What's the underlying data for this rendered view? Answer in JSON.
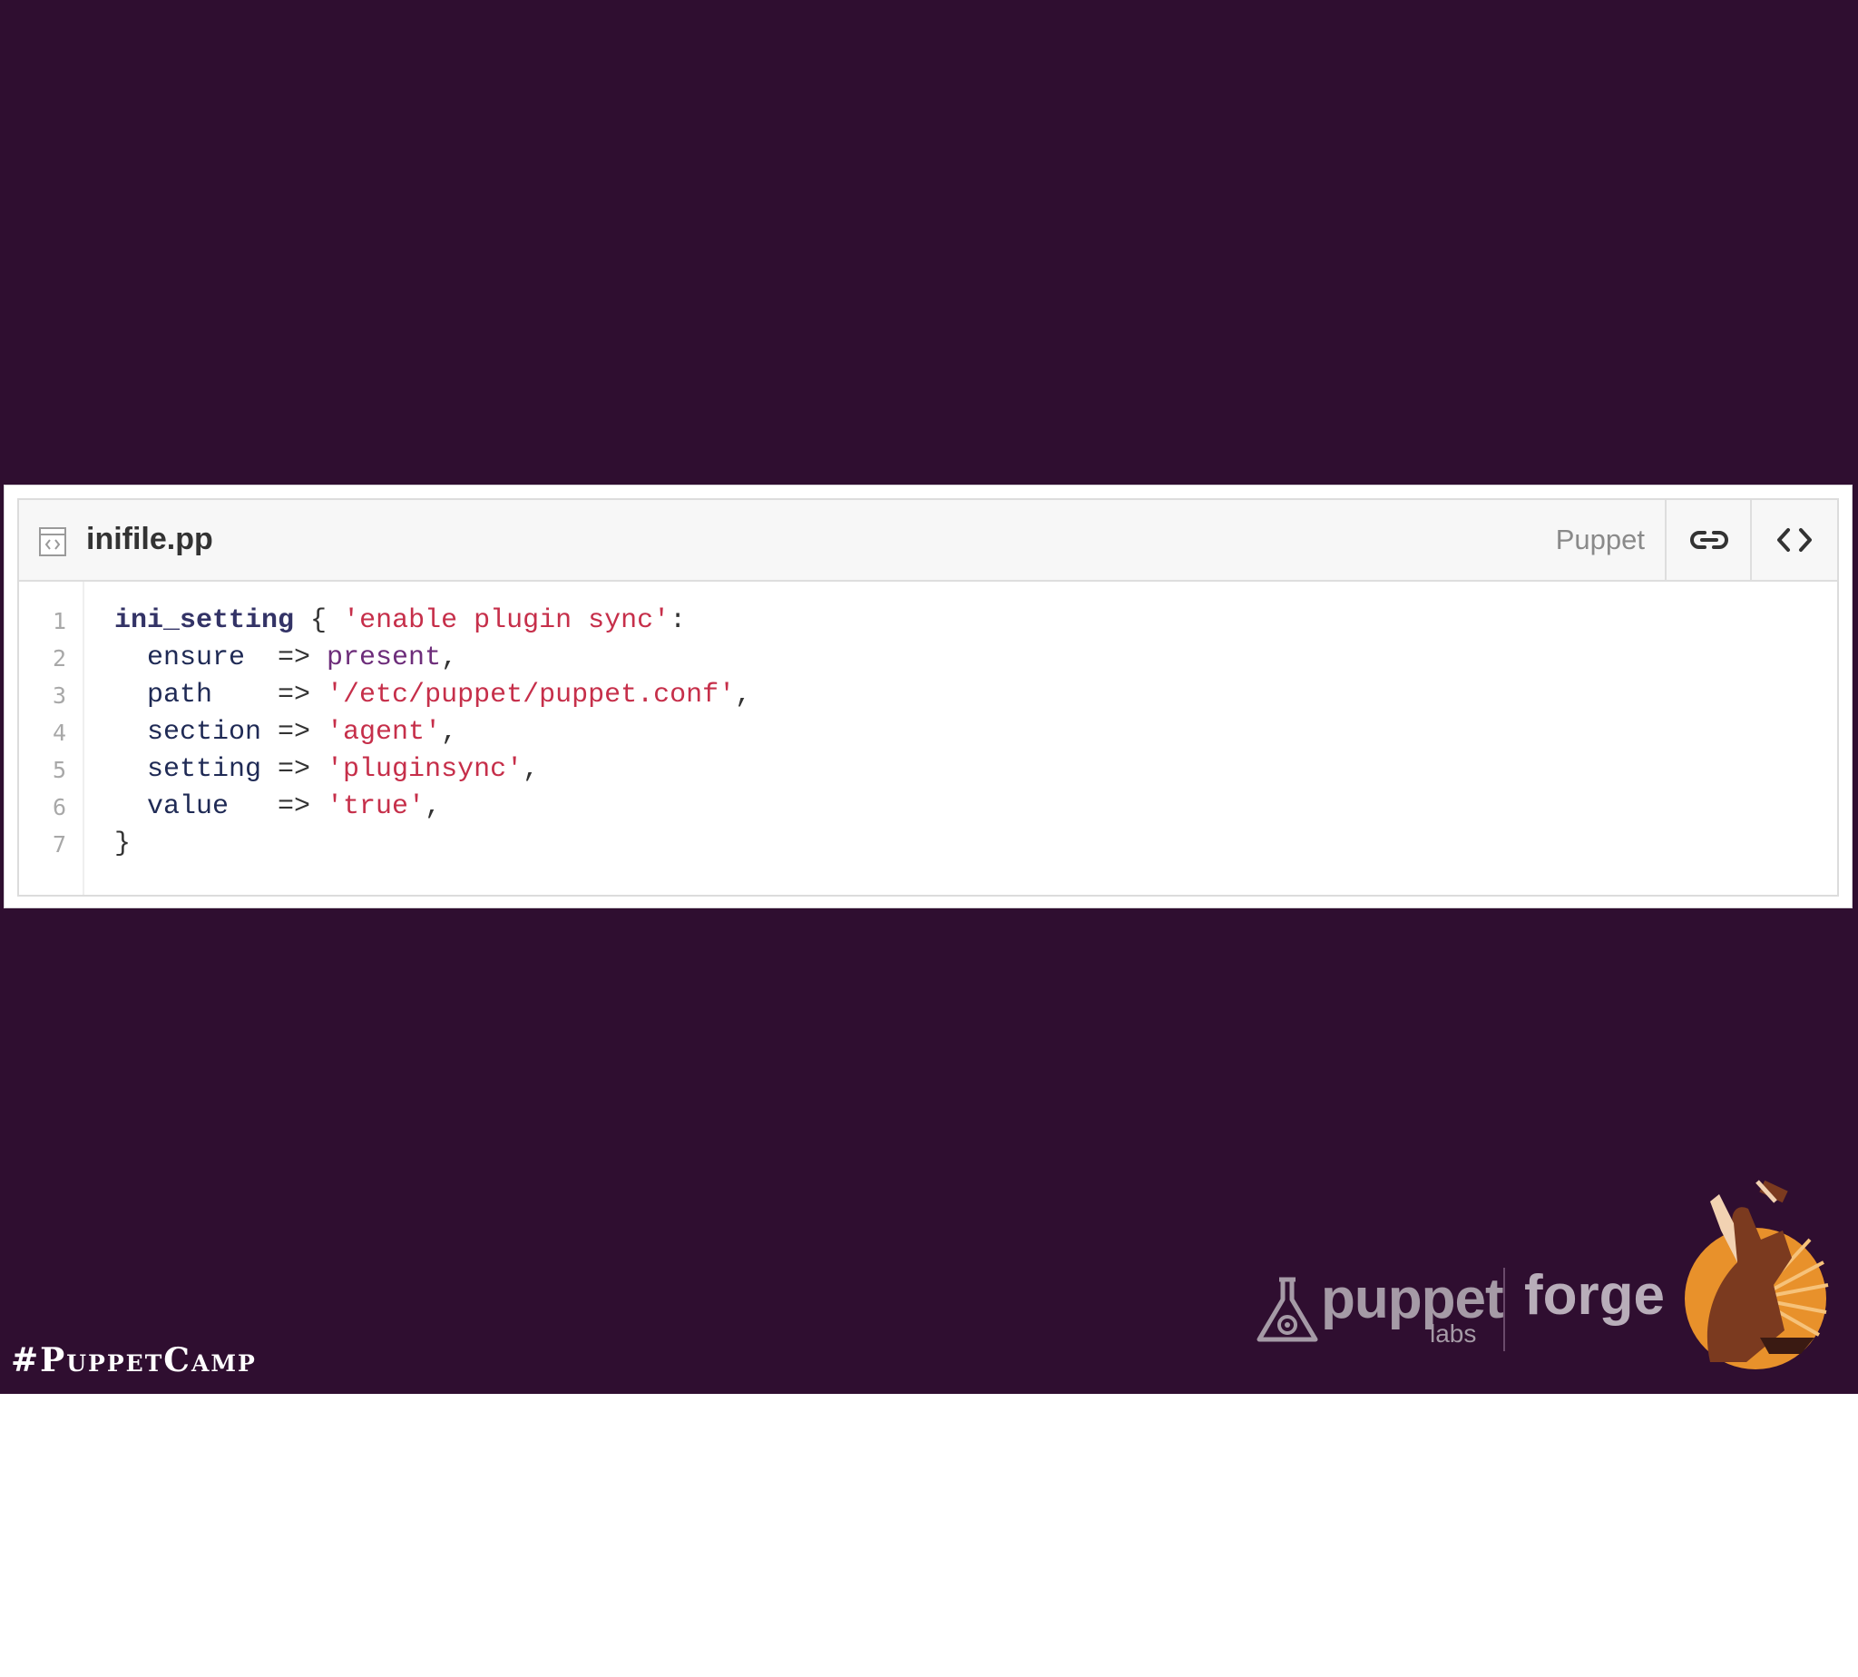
{
  "gist": {
    "filename": "inifile.pp",
    "language": "Puppet",
    "line_numbers": [
      "1",
      "2",
      "3",
      "4",
      "5",
      "6",
      "7"
    ],
    "lines": [
      [
        {
          "t": "ini_setting",
          "c": "kw"
        },
        {
          "t": " { ",
          "c": "op"
        },
        {
          "t": "'enable plugin sync'",
          "c": "str"
        },
        {
          "t": ":",
          "c": "op"
        }
      ],
      [
        {
          "t": "  ensure  ",
          "c": "attr"
        },
        {
          "t": "=> ",
          "c": "op"
        },
        {
          "t": "present",
          "c": "val"
        },
        {
          "t": ",",
          "c": "op"
        }
      ],
      [
        {
          "t": "  path    ",
          "c": "attr"
        },
        {
          "t": "=> ",
          "c": "op"
        },
        {
          "t": "'/etc/puppet/puppet.conf'",
          "c": "str"
        },
        {
          "t": ",",
          "c": "op"
        }
      ],
      [
        {
          "t": "  section ",
          "c": "attr"
        },
        {
          "t": "=> ",
          "c": "op"
        },
        {
          "t": "'agent'",
          "c": "str"
        },
        {
          "t": ",",
          "c": "op"
        }
      ],
      [
        {
          "t": "  setting ",
          "c": "attr"
        },
        {
          "t": "=> ",
          "c": "op"
        },
        {
          "t": "'pluginsync'",
          "c": "str"
        },
        {
          "t": ",",
          "c": "op"
        }
      ],
      [
        {
          "t": "  value   ",
          "c": "attr"
        },
        {
          "t": "=> ",
          "c": "op"
        },
        {
          "t": "'true'",
          "c": "str"
        },
        {
          "t": ",",
          "c": "op"
        }
      ],
      [
        {
          "t": "}",
          "c": "op"
        }
      ]
    ]
  },
  "branding": {
    "hashtag": "#PuppetCamp",
    "puppet_word": "puppet",
    "labs_word": "labs",
    "forge_word": "forge"
  },
  "icons": {
    "file": "file-code-icon",
    "permalink": "link-icon",
    "embed": "code-icon",
    "puppet_logo": "puppet-flask-icon",
    "mascot": "blacksmith-icon"
  },
  "colors": {
    "background": "#2f0e30",
    "string": "#c62f4a",
    "keyword": "#333366",
    "value": "#6d2d7a"
  }
}
